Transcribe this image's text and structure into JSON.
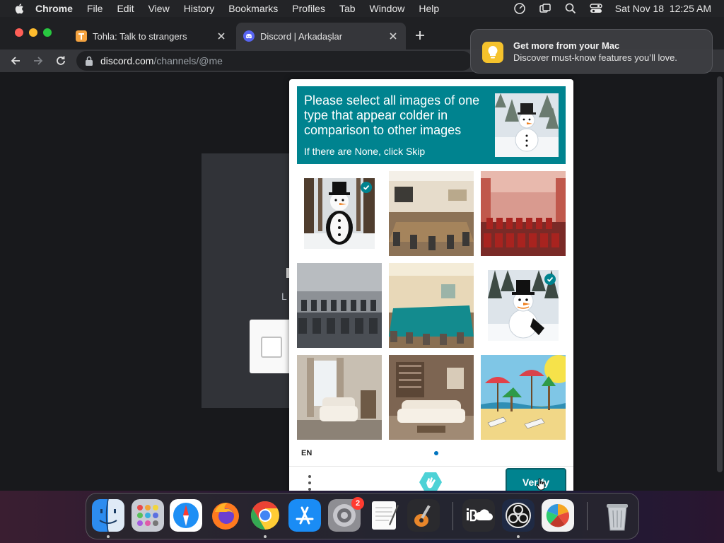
{
  "menubar": {
    "app_name": "Chrome",
    "items": [
      "File",
      "Edit",
      "View",
      "History",
      "Bookmarks",
      "Profiles",
      "Tab",
      "Window",
      "Help"
    ],
    "datetime": "Sat Nov 18  12:25 AM"
  },
  "browser": {
    "tabs": [
      {
        "title": "Tohla: Talk to strangers",
        "active": false
      },
      {
        "title": "Discord | Arkadaşlar",
        "active": true
      }
    ],
    "address": {
      "host": "discord.com",
      "path": "/channels/@me"
    }
  },
  "notification": {
    "title": "Get more from your Mac",
    "body": "Discover must-know features you’ll love."
  },
  "discord": {
    "subtitle_fragment": "L"
  },
  "challenge": {
    "prompt": "Please select all images of one type that appear colder in comparison to other images",
    "hint": "If there are None, click Skip",
    "example_icon": "snowman-example-image",
    "tiles": [
      {
        "subject": "snowman",
        "selected": true
      },
      {
        "subject": "conference-room",
        "selected": false
      },
      {
        "subject": "red-chairs-hall",
        "selected": false
      },
      {
        "subject": "chairs-rows",
        "selected": false
      },
      {
        "subject": "teal-meeting-room",
        "selected": false
      },
      {
        "subject": "snowman",
        "selected": true
      },
      {
        "subject": "armchair-living-room",
        "selected": false
      },
      {
        "subject": "sofa-living-room",
        "selected": false
      },
      {
        "subject": "beach-umbrellas",
        "selected": false
      }
    ],
    "language": "EN",
    "verify_label": "Verify",
    "accent": "#00838f"
  },
  "dock": {
    "apps": [
      "Finder",
      "Launchpad",
      "Safari",
      "Firefox",
      "Chrome",
      "App Store",
      "System Settings",
      "TextEdit",
      "GarageBand",
      "iBoysoft",
      "OBS",
      "Color Picker",
      "Trash"
    ],
    "settings_badge": "2"
  }
}
